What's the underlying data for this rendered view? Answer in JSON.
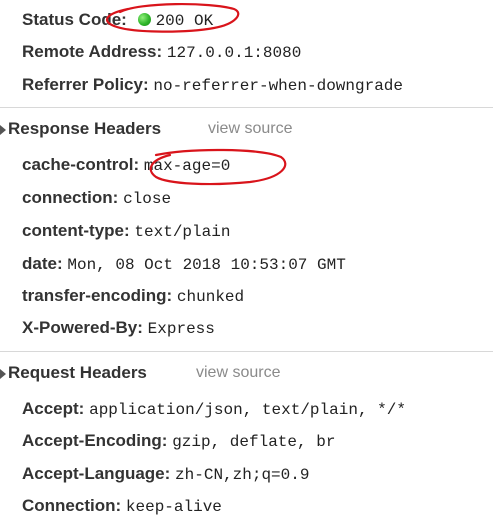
{
  "general": {
    "status_code_label": "Status Code:",
    "status_code_value": "200 OK",
    "remote_address_label": "Remote Address:",
    "remote_address_value": "127.0.0.1:8080",
    "referrer_policy_label": "Referrer Policy:",
    "referrer_policy_value": "no-referrer-when-downgrade"
  },
  "response_headers": {
    "title": "Response Headers",
    "view_source": "view source",
    "items": [
      {
        "key": "cache-control:",
        "value": "max-age=0"
      },
      {
        "key": "connection:",
        "value": "close"
      },
      {
        "key": "content-type:",
        "value": "text/plain"
      },
      {
        "key": "date:",
        "value": "Mon, 08 Oct 2018 10:53:07 GMT"
      },
      {
        "key": "transfer-encoding:",
        "value": "chunked"
      },
      {
        "key": "X-Powered-By:",
        "value": "Express"
      }
    ]
  },
  "request_headers": {
    "title": "Request Headers",
    "view_source": "view source",
    "items": [
      {
        "key": "Accept:",
        "value": "application/json, text/plain, */*"
      },
      {
        "key": "Accept-Encoding:",
        "value": "gzip, deflate, br"
      },
      {
        "key": "Accept-Language:",
        "value": "zh-CN,zh;q=0.9"
      },
      {
        "key": "Connection:",
        "value": "keep-alive"
      }
    ]
  },
  "colors": {
    "status_ok": "#2fb52a",
    "annotation": "#d9141b"
  }
}
